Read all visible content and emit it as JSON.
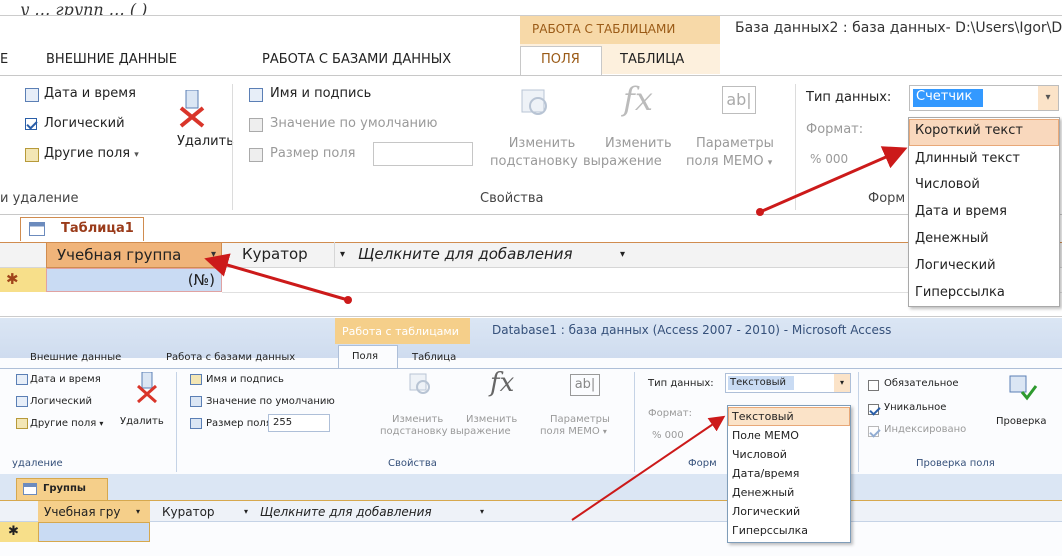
{
  "top_caption": "у         …          групп        …         (           )",
  "top": {
    "context_tab": "РАБОТА С ТАБЛИЦАМИ",
    "title": "База данных2 : база данных- D:\\Users\\Igor\\D",
    "tabs": [
      "Е",
      "ВНЕШНИЕ ДАННЫЕ",
      "РАБОТА С БАЗАМИ ДАННЫХ",
      "ПОЛЯ",
      "ТАБЛИЦА"
    ],
    "ribbon": {
      "date_time": "Дата и время",
      "logical": "Логический",
      "other_fields": "Другие поля",
      "delete": "Удалить",
      "group_add_delete": "и удаление",
      "name_caption": "Имя и подпись",
      "default_value": "Значение по умолчанию",
      "field_size": "Размер поля",
      "change_lookup_1": "Изменить",
      "change_lookup_2": "подстановку",
      "change_expr_1": "Изменить",
      "change_expr_2": "выражение",
      "memo_params_1": "Параметры",
      "memo_params_2": "поля МЕМО",
      "group_properties": "Свойства",
      "data_type_label": "Тип данных:",
      "data_type_value": "Счетчик",
      "format_label": "Формат:",
      "format_group": "Форм"
    },
    "dropdown": [
      "Короткий текст",
      "Длинный текст",
      "Числовой",
      "Дата и время",
      "Денежный",
      "Логический",
      "Гиперссылка"
    ],
    "doc_tab": "Таблица1",
    "columns": [
      "Учебная группа",
      "Куратор",
      "Щелкните для добавления"
    ],
    "new_row_marker": "✱",
    "new_row_value": "(№)",
    "chevron": "▾"
  },
  "bottom": {
    "context_tab": "Работа с таблицами",
    "title": "Database1 : база данных (Access 2007 - 2010) - Microsoft Access",
    "tabs": [
      "Внешние данные",
      "Работа с базами данных",
      "Поля",
      "Таблица"
    ],
    "ribbon": {
      "date_time": "Дата и время",
      "logical": "Логический",
      "other_fields": "Другие поля",
      "delete": "Удалить",
      "group_add_delete": "удаление",
      "name_caption": "Имя и подпись",
      "default_value": "Значение по умолчанию",
      "field_size": "Размер поля",
      "field_size_value": "255",
      "change_lookup_1": "Изменить",
      "change_lookup_2": "подстановку",
      "change_expr_1": "Изменить",
      "change_expr_2": "выражение",
      "memo_params_1": "Параметры",
      "memo_params_2": "поля МЕМО",
      "group_properties": "Свойства",
      "data_type_label": "Тип данных:",
      "data_type_value": "Текстовый",
      "format_label": "Формат:",
      "format_group": "Форм",
      "required": "Обязательное",
      "unique": "Уникальное",
      "indexed": "Индексировано",
      "validation": "Проверка",
      "group_validation": "Проверка поля"
    },
    "dropdown": [
      "Текстовый",
      "Поле МЕМО",
      "Числовой",
      "Дата/время",
      "Денежный",
      "Логический",
      "Гиперссылка"
    ],
    "doc_tab": "Группы",
    "columns": [
      "Учебная гру",
      "Куратор",
      "Щелкните для добавления"
    ],
    "new_row_marker": "✱",
    "chevron": "▾"
  },
  "colors": {
    "accent_orange": "#f0b47a",
    "context_tab": "#f5cf8a",
    "arrow": "#cc1a1a",
    "ribbon_bg": "#ffffff",
    "selection": "#3399ff"
  }
}
